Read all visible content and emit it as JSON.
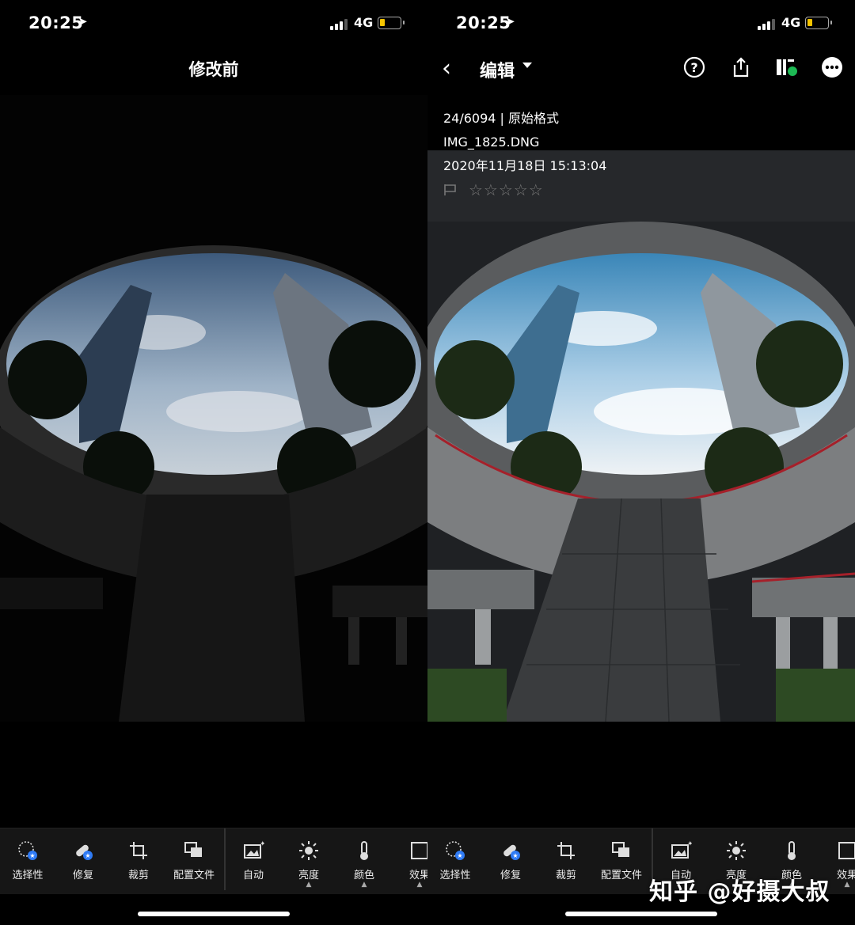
{
  "status_bar": {
    "time": "20:25",
    "network": "4G"
  },
  "left": {
    "title": "修改前",
    "tools": [
      {
        "label": "选择性",
        "icon": "selective-icon"
      },
      {
        "label": "修复",
        "icon": "heal-icon"
      },
      {
        "label": "裁剪",
        "icon": "crop-icon"
      },
      {
        "label": "配置文件",
        "icon": "profile-icon"
      },
      {
        "label": "自动",
        "icon": "auto-icon"
      },
      {
        "label": "亮度",
        "icon": "light-icon"
      },
      {
        "label": "颜色",
        "icon": "color-icon"
      },
      {
        "label": "效果",
        "icon": "effects-icon"
      }
    ]
  },
  "right": {
    "nav": {
      "mode_label": "编辑"
    },
    "info": {
      "counter_format": "24/6094 | 原始格式",
      "filename": "IMG_1825.DNG",
      "datetime": "2020年11月18日 15:13:04",
      "stars": "☆☆☆☆☆"
    },
    "tools": [
      {
        "label": "选择性",
        "icon": "selective-icon"
      },
      {
        "label": "修复",
        "icon": "heal-icon"
      },
      {
        "label": "裁剪",
        "icon": "crop-icon"
      },
      {
        "label": "配置文件",
        "icon": "profile-icon"
      },
      {
        "label": "自动",
        "icon": "auto-icon"
      },
      {
        "label": "亮度",
        "icon": "light-icon"
      },
      {
        "label": "颜色",
        "icon": "color-icon"
      },
      {
        "label": "效果",
        "icon": "effects-icon"
      }
    ]
  },
  "watermark": "知乎 @好摄大叔",
  "colors": {
    "accent_blue": "#2f7bf5",
    "battery": "#f5c400",
    "cloud_dot": "#1db954",
    "toolbar_bg": "#161616"
  }
}
